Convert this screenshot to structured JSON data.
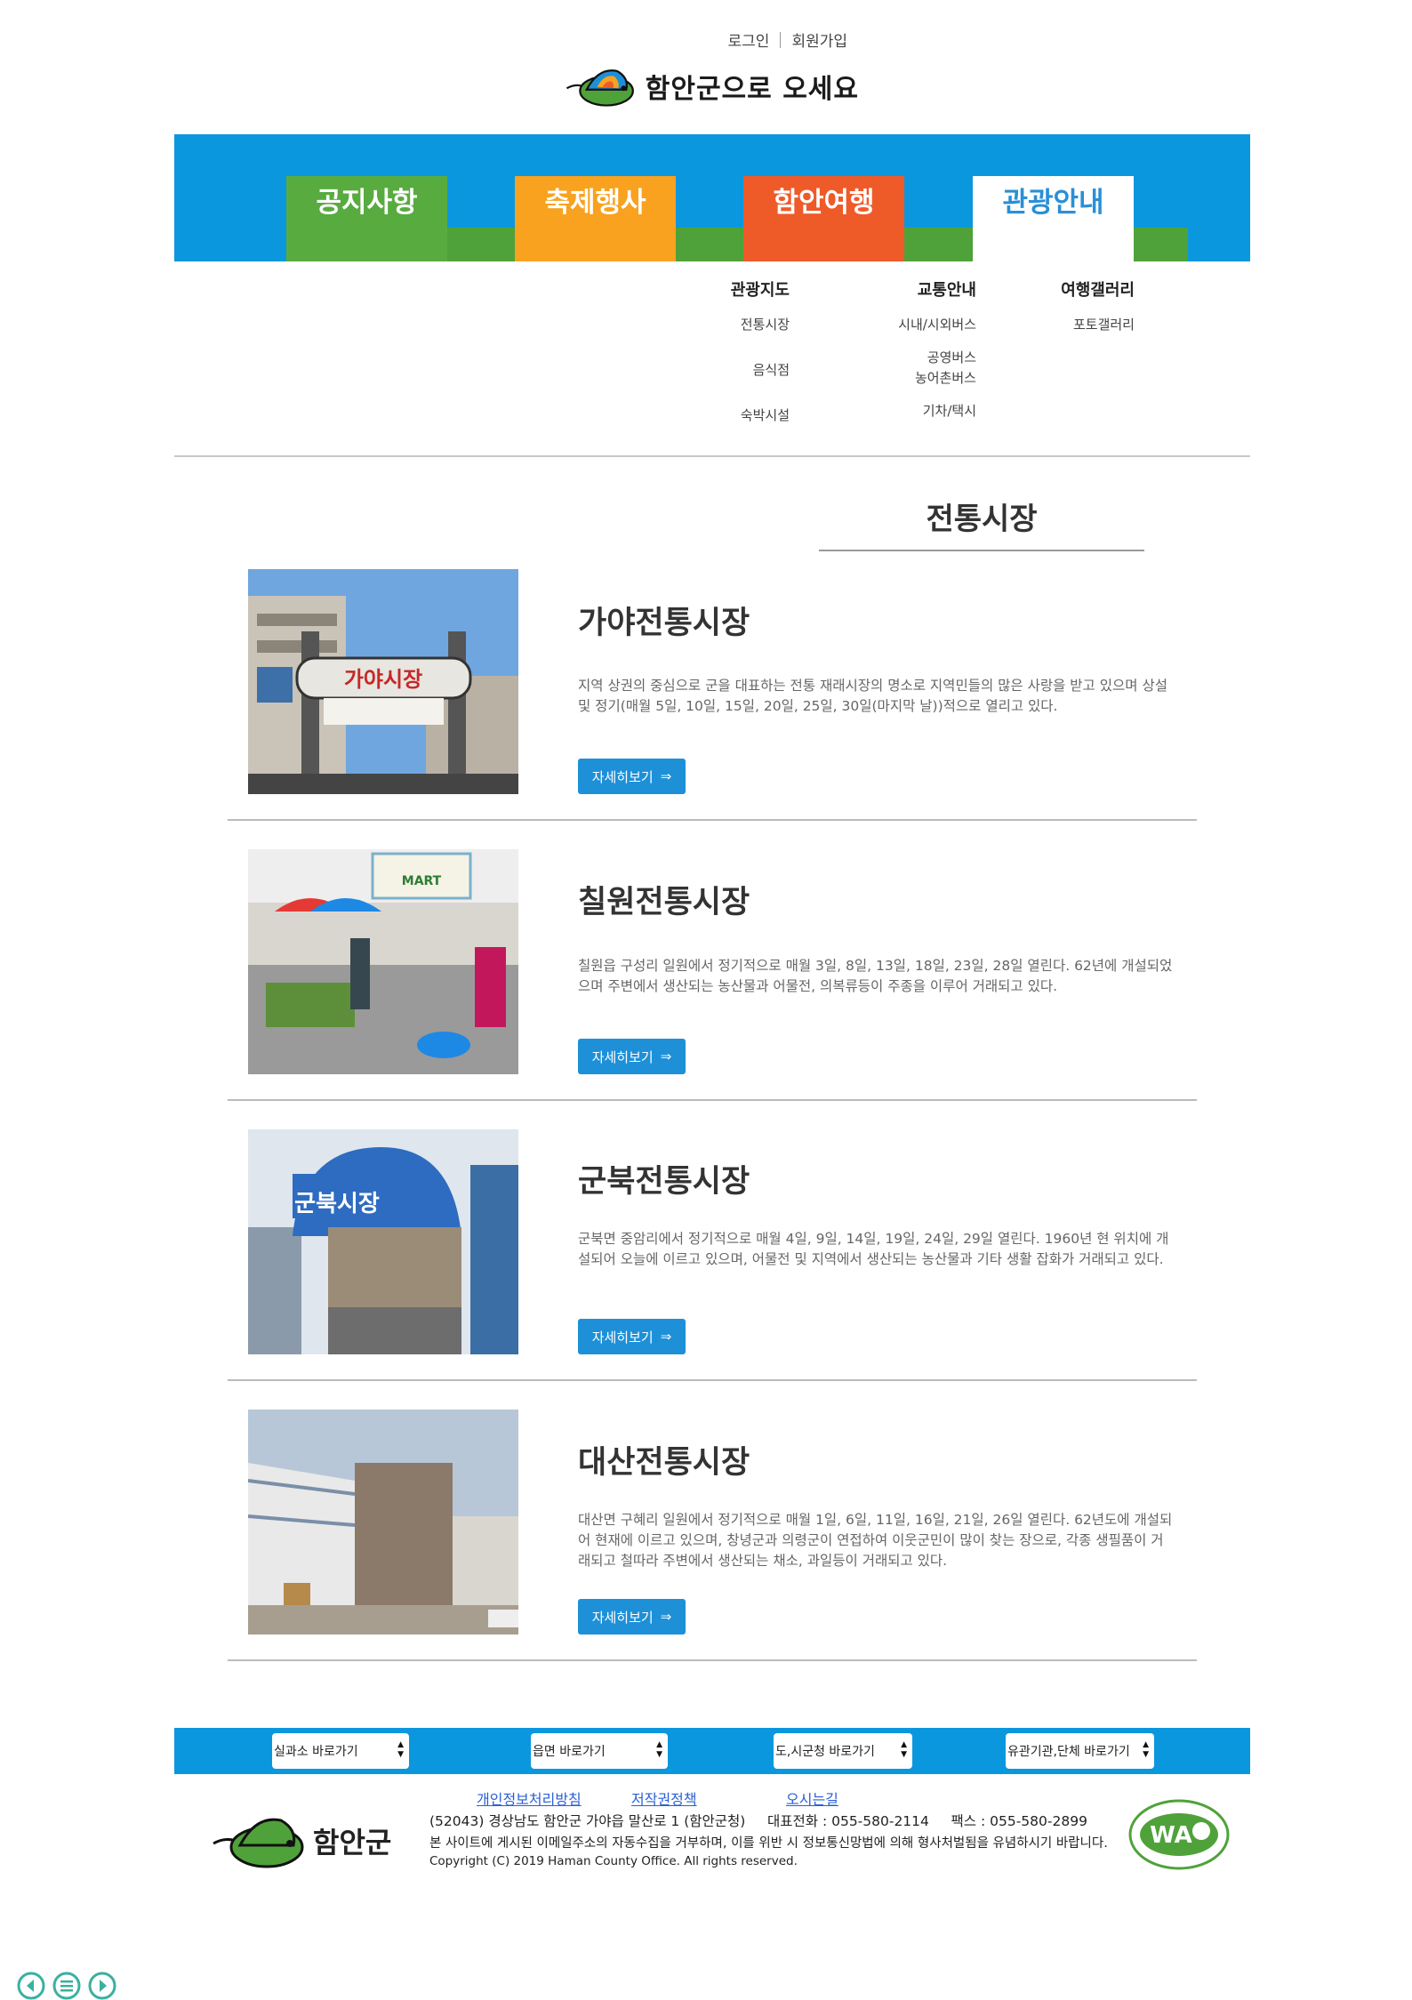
{
  "header": {
    "login": "로그인",
    "signup": "회원가입",
    "logo_text": "함안군으로 오세요"
  },
  "nav": {
    "tabs": [
      {
        "label": "공지사항"
      },
      {
        "label": "축제행사"
      },
      {
        "label": "함안여행"
      },
      {
        "label": "관광안내"
      }
    ],
    "active": "관광안내"
  },
  "submenu": {
    "col1": {
      "head": "관광지도",
      "items": [
        "전통시장",
        "음식점",
        "숙박시설"
      ]
    },
    "col2": {
      "head": "교통안내",
      "items": [
        "시내/시외버스",
        "공영버스",
        "농어촌버스",
        "기차/택시"
      ]
    },
    "col3": {
      "head": "여행갤러리",
      "items": [
        "포토갤러리"
      ]
    }
  },
  "page_title": "전통시장",
  "markets": [
    {
      "title": "가야전통시장",
      "desc": "지역 상권의 중심으로 군을 대표하는 전통 재래시장의 명소로 지역민들의 많은 사랑을 받고 있으며 상설 및 정기(매월 5일, 10일, 15일, 20일, 25일, 30일(마지막 날))적으로 열리고 있다.",
      "button": "자세히보기",
      "sign": "가야시장"
    },
    {
      "title": "칠원전통시장",
      "desc": "칠원읍 구성리 일원에서 정기적으로 매월 3일, 8일, 13일, 18일, 23일, 28일 열린다. 62년에 개설되었으며 주변에서 생산되는 농산물과 어물전, 의복류등이 주종을 이루어 거래되고 있다.",
      "button": "자세히보기",
      "sign": "MART"
    },
    {
      "title": "군북전통시장",
      "desc": "군북면 중암리에서 정기적으로 매월 4일, 9일, 14일, 19일, 24일, 29일 열린다. 1960년 현 위치에 개설되어 오늘에 이르고 있으며, 어물전 및 지역에서 생산되는 농산물과 기타 생활 잡화가 거래되고 있다.",
      "button": "자세히보기",
      "sign": "군북시장"
    },
    {
      "title": "대산전통시장",
      "desc": "대산면 구혜리 일원에서 정기적으로 매월 1일, 6일, 11일, 16일, 21일, 26일 열린다. 62년도에 개설되어 현재에 이르고 있으며, 창녕군과 의령군이 연접하여 이웃군민이 많이 찾는 장으로, 각종 생필품이 거래되고 철따라 주변에서 생산되는 채소, 과일등이 거래되고 있다.",
      "button": "자세히보기",
      "sign": ""
    }
  ],
  "footer": {
    "selects": [
      "실과소 바로가기",
      "읍면 바로가기",
      "도,시군청 바로가기",
      "유관기관,단체 바로가기"
    ],
    "links": [
      "개인정보처리방침",
      "저작권정책",
      "오시는길"
    ],
    "address": "(52043) 경상남도 함안군 가야읍 말산로 1 (함안군청)     대표전화 : 055-580-2114     팩스 : 055-580-2899",
    "notice": "본 사이트에 게시된 이메일주소의 자동수집을 거부하며, 이를 위반 시 정보통신망법에 의해 형사처벌됨을 유념하시기 바랍니다.",
    "copyright": "Copyright (C) 2019 Haman County Office. All rights reserved.",
    "logo_text": "함안군",
    "wa_text": "WA"
  },
  "colors": {
    "nav_blue": "#0b97de",
    "tab_green": "#58ab3f",
    "tab_orange": "#f8a21f",
    "tab_red": "#ef5a29",
    "active_tab_text": "#2a8fd6",
    "button_blue": "#1e90d8"
  }
}
